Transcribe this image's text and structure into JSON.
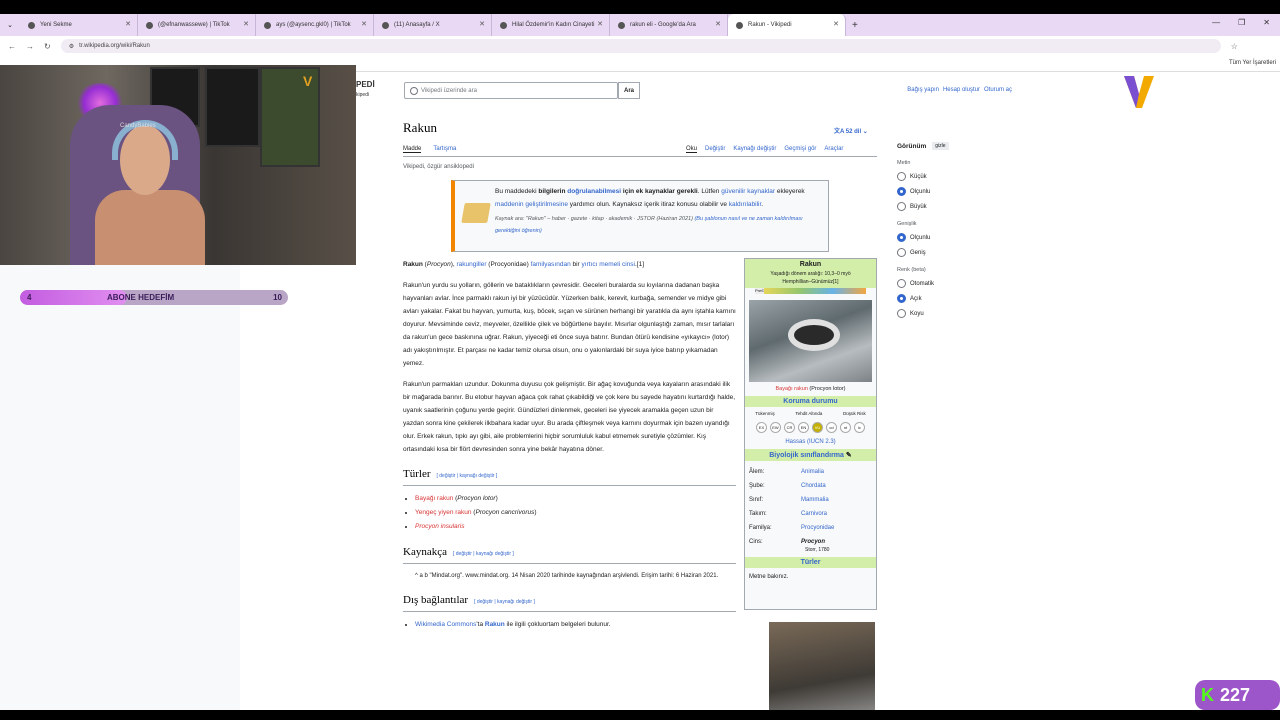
{
  "browser": {
    "tabs": [
      {
        "title": "Yeni Sekme"
      },
      {
        "title": "(@efnanwassewe) | TikTok"
      },
      {
        "title": "ays (@aysenc.gkl0) | TikTok"
      },
      {
        "title": "(11) Anasayfa / X"
      },
      {
        "title": "Hilal Özdemir'in Kadın Cinayeti"
      },
      {
        "title": "rakun eli - Google'da Ara"
      },
      {
        "title": "Rakun - Vikipedi"
      }
    ],
    "url": "tr.wikipedia.org/wiki/Rakun",
    "bookmarks_label": "Tüm Yer İşaretleri"
  },
  "overlay": {
    "webcam_name": "CandyBabies",
    "goal_current": "4",
    "goal_label": "ABONE HEDEFİM",
    "goal_target": "10",
    "goal_progress": 0.4,
    "follower_count": "227"
  },
  "wiki": {
    "wordmark": "PEDİ",
    "wordmark_sub": "kipedi",
    "search_placeholder": "Vikipedi üzerinde ara",
    "search_button": "Ara",
    "top_links": [
      "Bağış yapın",
      "Hesap oluştur",
      "Oturum aç"
    ],
    "title": "Rakun",
    "lang_count": "52 dil",
    "tabs_left": [
      "Madde",
      "Tartışma"
    ],
    "tabs_right": [
      "Oku",
      "Değiştir",
      "Kaynağı değiştir",
      "Geçmişi gör",
      "Araçlar"
    ],
    "tagline": "Vikipedi, özgür ansiklopedi",
    "ambox": {
      "line1a": "Bu maddedeki ",
      "line1b": "bilgilerin ",
      "line1c": "doğrulanabilmesi",
      "line1d": " için ek kaynaklar gerekli",
      "line1e": ". Lütfen ",
      "line1f": "güvenilir kaynaklar",
      "line2a": " ekleyerek ",
      "line2b": "maddenin geliştirilmesine",
      "line2c": " yardımcı olun. Kaynaksız içerik itiraz konusu olabilir ve ",
      "line2d": "kaldırılabilir",
      "line2e": ".",
      "small1": "Kaynak ara: \"Rakun\" – haber · gazete · kitap · akademik · JSTOR",
      "small2": " (Haziran 2021) ",
      "small3": "(Bu şablonun nasıl ve ne zaman kaldırılması gerektiğini öğrenin)"
    },
    "intro": {
      "bold": "Rakun",
      "a": " (",
      "b": "Procyon",
      "c": "), ",
      "d": "rakungiller",
      "e": " (Procyonidae) ",
      "f": "familyasından",
      "g": " bir ",
      "h": "yırtıcı memeli cinsi",
      "i": ".[1]"
    },
    "p2": "Rakun'un yurdu su yolların, göllerin ve bataklıkların çevresidir. Geceleri buralarda su kıyılarına dadanan başka hayvanları avlar. İnce parmaklı rakun iyi bir yüzücüdür. Yüzerken balık, kerevit, kurbağa, semender ve midye gibi avları yakalar. Fakat bu hayvan, yumurta, kuş, böcek, sıçan ve sürünen herhangi bir yaratıkla da aynı iştahla karnını doyurur. Mevsiminde ceviz, meyveler, özellikle çilek ve böğürtlene bayılır. Mısırlar olgunlaştığı zaman, mısır tarlaları da rakun'un gece baskınına uğrar. Rakun, yiyeceği eti önce suya batırır. Bundan ötürü kendisine «yıkayıcı» (lotor) adı yakıştırılmıştır. Et parçası ne kadar temiz olursa olsun, onu o yakınlardaki bir suya iyice batırıp yıkamadan yemez.",
    "p3": "Rakun'un parmakları uzundur. Dokunma duyusu çok gelişmiştir. Bir ağaç kovuğunda veya kayaların arasındaki ilik bir mağarada barınır. Bu etobur hayvan ağaca çok rahat çıkabildiği ve çok kere bu sayede hayatını kurtardığı halde, uyanık saatlerinin çoğunu yerde geçirir. Gündüzleri dinlenmek, geceleri ise yiyecek aramakla geçen uzun bir yazdan sonra kine çekilerek ilkbahara kadar uyur. Bu arada çiftleşmek veya karnını doyurmak için bazen uyandığı olur. Erkek rakun, tıpkı ayı gibi, aile problemlerini hiçbir sorumluluk kabul etmemek suretiyle çözümler. Kış ortasındaki kısa bir flört devresinden sonra yine bekâr hayatına döner.",
    "edit_labels": "[ değiştir | kaynağı değiştir ]",
    "h_turler": "Türler",
    "species": [
      {
        "a": "Bayağı rakun",
        "b": " (",
        "c": "Procyon lotor",
        "d": ")"
      },
      {
        "a": "Yengeç yiyen rakun",
        "b": " (",
        "c": "Procyon cancrivorus",
        "d": ")"
      },
      {
        "a": "Procyon insularis",
        "b": "",
        "c": "",
        "d": ""
      }
    ],
    "h_kaynakca": "Kaynakça",
    "ref1": "^ a b \"Mindat.org\". www.mindat.org. 14 Nisan 2020 tarihinde kaynağından arşivlendi. Erişim tarihi: 6 Haziran 2021.",
    "h_dis": "Dış bağlantılar",
    "ext_a": "Wikimedia Commons",
    "ext_b": "'ta ",
    "ext_c": "Rakun",
    "ext_d": " ile ilgili çokluortam belgeleri bulunur.",
    "infobox": {
      "title": "Rakun",
      "range1": "Yaşadığı dönem aralığı: 10,3–0 myö",
      "range2": "Hemphillian–Günümüz[1]",
      "range_tag": "PreЄ",
      "caption_a": "Bayağı rakun",
      "caption_b": " (Procyon lotor)",
      "sec_cons": "Koruma durumu",
      "cons_labels": [
        "Tükenmiş",
        "Tehdit Altında",
        "Düşük Risk"
      ],
      "cons_codes": [
        "EX",
        "EW",
        "CR",
        "EN",
        "VU",
        "cd",
        "nt",
        "lc"
      ],
      "hassas": "Hassas (IUCN 2.3)",
      "sec_taxo": "Biyolojik sınıflandırma",
      "taxo": [
        {
          "k": "Âlem:",
          "v": "Animalia"
        },
        {
          "k": "Şube:",
          "v": "Chordata"
        },
        {
          "k": "Sınıf:",
          "v": "Mammalia"
        },
        {
          "k": "Takım:",
          "v": "Carnivora"
        },
        {
          "k": "Familya:",
          "v": "Procyonidae"
        },
        {
          "k": "Cins:",
          "v": "Procyon"
        }
      ],
      "authority": "Storr, 1780",
      "sec_species": "Türler",
      "metne": "Metne bakınız."
    },
    "prefs": {
      "title": "Görünüm",
      "hide": "gizle",
      "g1": "Metin",
      "g1_opts": [
        "Küçük",
        "Olçunlu",
        "Büyük"
      ],
      "g2": "Genişlik",
      "g2_opts": [
        "Olçunlu",
        "Geniş"
      ],
      "g3": "Renk (beta)",
      "g3_opts": [
        "Otomatik",
        "Açık",
        "Koyu"
      ]
    }
  }
}
